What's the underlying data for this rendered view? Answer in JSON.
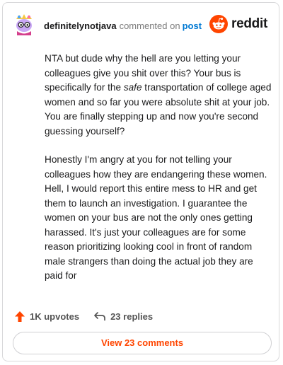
{
  "comment": {
    "username": "definitelynotjava",
    "action_text": "commented on",
    "link_text": "post",
    "paragraphs": [
      {
        "before": "NTA but dude why the hell are you letting your colleagues give you shit over this? Your bus is specifically for the ",
        "emphasis": "safe",
        "after": " transportation of college aged women and so far you were absolute shit at your job. You are finally stepping up and now you're second guessing yourself?"
      },
      {
        "before": "Honestly I'm angry at you for not telling your colleagues how they are endangering these women. Hell, I would report this entire mess to HR and get them to launch an investigation. I guarantee the women on your bus are not the only ones getting harassed. It's just your colleagues are for some reason prioritizing looking cool in front of random male strangers than doing the actual job they are paid for",
        "emphasis": "",
        "after": ""
      }
    ],
    "upvotes": "1K upvotes",
    "replies": "23 replies",
    "view_button": "View 23 comments"
  },
  "brand": {
    "name": "reddit",
    "color": "#ff4500"
  },
  "icons": {
    "avatar": "snoo-avatar",
    "logo": "reddit-logo-icon",
    "upvote": "upvote-arrow-icon",
    "reply": "reply-arrow-icon"
  },
  "colors": {
    "accent": "#ff4500",
    "link": "#0079d3",
    "muted": "#7c7c7c"
  }
}
